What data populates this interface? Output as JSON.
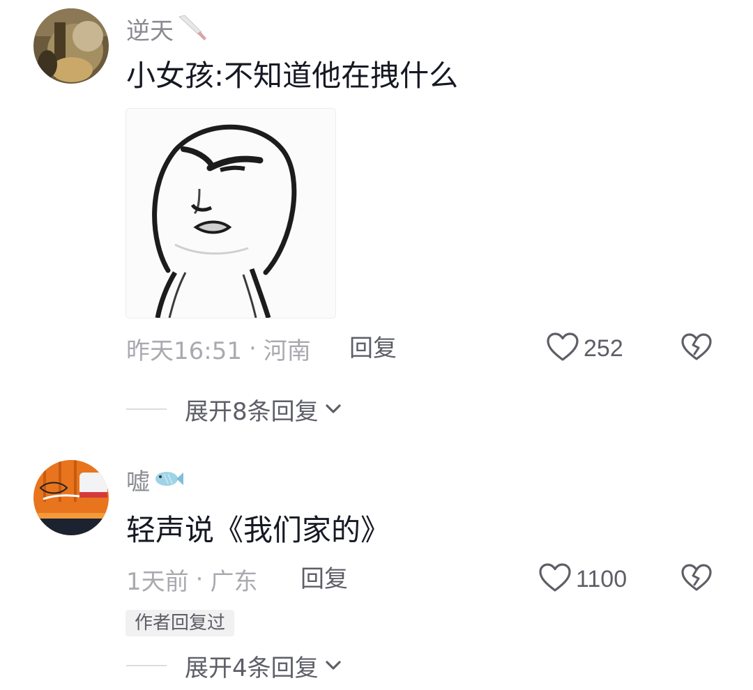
{
  "comments": [
    {
      "username": "逆天",
      "username_emoji_icon": "knife-icon",
      "text": "小女孩:不知道他在拽什么",
      "has_sticker": true,
      "time": "昨天16:51",
      "separator": "·",
      "location": "河南",
      "reply_label": "回复",
      "likes": "252",
      "expand_label": "展开8条回复",
      "author_replied": ""
    },
    {
      "username": "嘘",
      "username_emoji_icon": "fish-icon",
      "text": "轻声说《我们家的》",
      "has_sticker": false,
      "time": "1天前",
      "separator": "·",
      "location": "广东",
      "reply_label": "回复",
      "likes": "1100",
      "expand_label": "展开4条回复",
      "author_replied": "作者回复过"
    }
  ],
  "colors": {
    "primary_text": "#161823",
    "secondary_text": "#8a8b91",
    "meta_text": "#a9aab0",
    "action_text": "#5d5e66",
    "badge_bg": "#f1f1f2"
  }
}
